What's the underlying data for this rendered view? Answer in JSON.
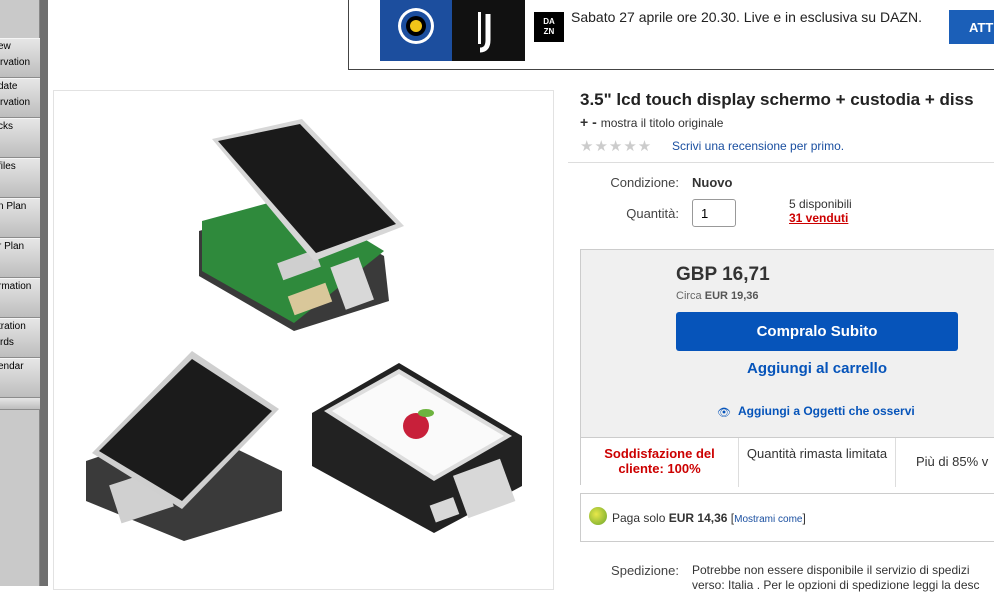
{
  "sidebar": {
    "items": [
      {
        "label": "ew\nrvation"
      },
      {
        "label": "date\nrvation"
      },
      {
        "label": "cks"
      },
      {
        "label": "files"
      },
      {
        "label": "n Plan"
      },
      {
        "label": "r Plan"
      },
      {
        "label": "rmation"
      },
      {
        "label": "tration\nrds"
      },
      {
        "label": "endar"
      }
    ]
  },
  "ad": {
    "text": "Sabato 27 aprile ore 20.30. Live e in esclusiva su DAZN.",
    "dazn_logo": "DA\nZN",
    "button_label": "ATT"
  },
  "product": {
    "title": "3.5\" lcd touch display schermo + custodia + diss",
    "orig_title_toggle": "+ -",
    "orig_title_label": "mostra il titolo originale",
    "stars": "★★★★★",
    "review_link": "Scrivi una recensione per primo.",
    "condition_label": "Condizione:",
    "condition_value": "Nuovo",
    "quantity_label": "Quantità:",
    "quantity_value": "1",
    "available": "5 disponibili",
    "sold": "31 venduti"
  },
  "buybox": {
    "price": "GBP 16,71",
    "approx_label": "Circa",
    "approx_value": "EUR 19,36",
    "buy_now": "Compralo Subito",
    "add_to_cart": "Aggiungi al carrello",
    "watch_icon": "eye-icon",
    "watch_label": "Aggiungi a Oggetti che osservi",
    "features": [
      "Soddisfazione del cliente: 100%",
      "Quantità rimasta limitata",
      "Più di 85% v"
    ]
  },
  "payment": {
    "text_prefix": "Paga solo",
    "amount": "EUR 14,36",
    "link": "Mostrami come"
  },
  "shipping": {
    "label": "Spedizione:",
    "line1": "Potrebbe non essere disponibile il servizio di spedizi",
    "line2": "verso: Italia . Per le opzioni di spedizione leggi la desc"
  }
}
